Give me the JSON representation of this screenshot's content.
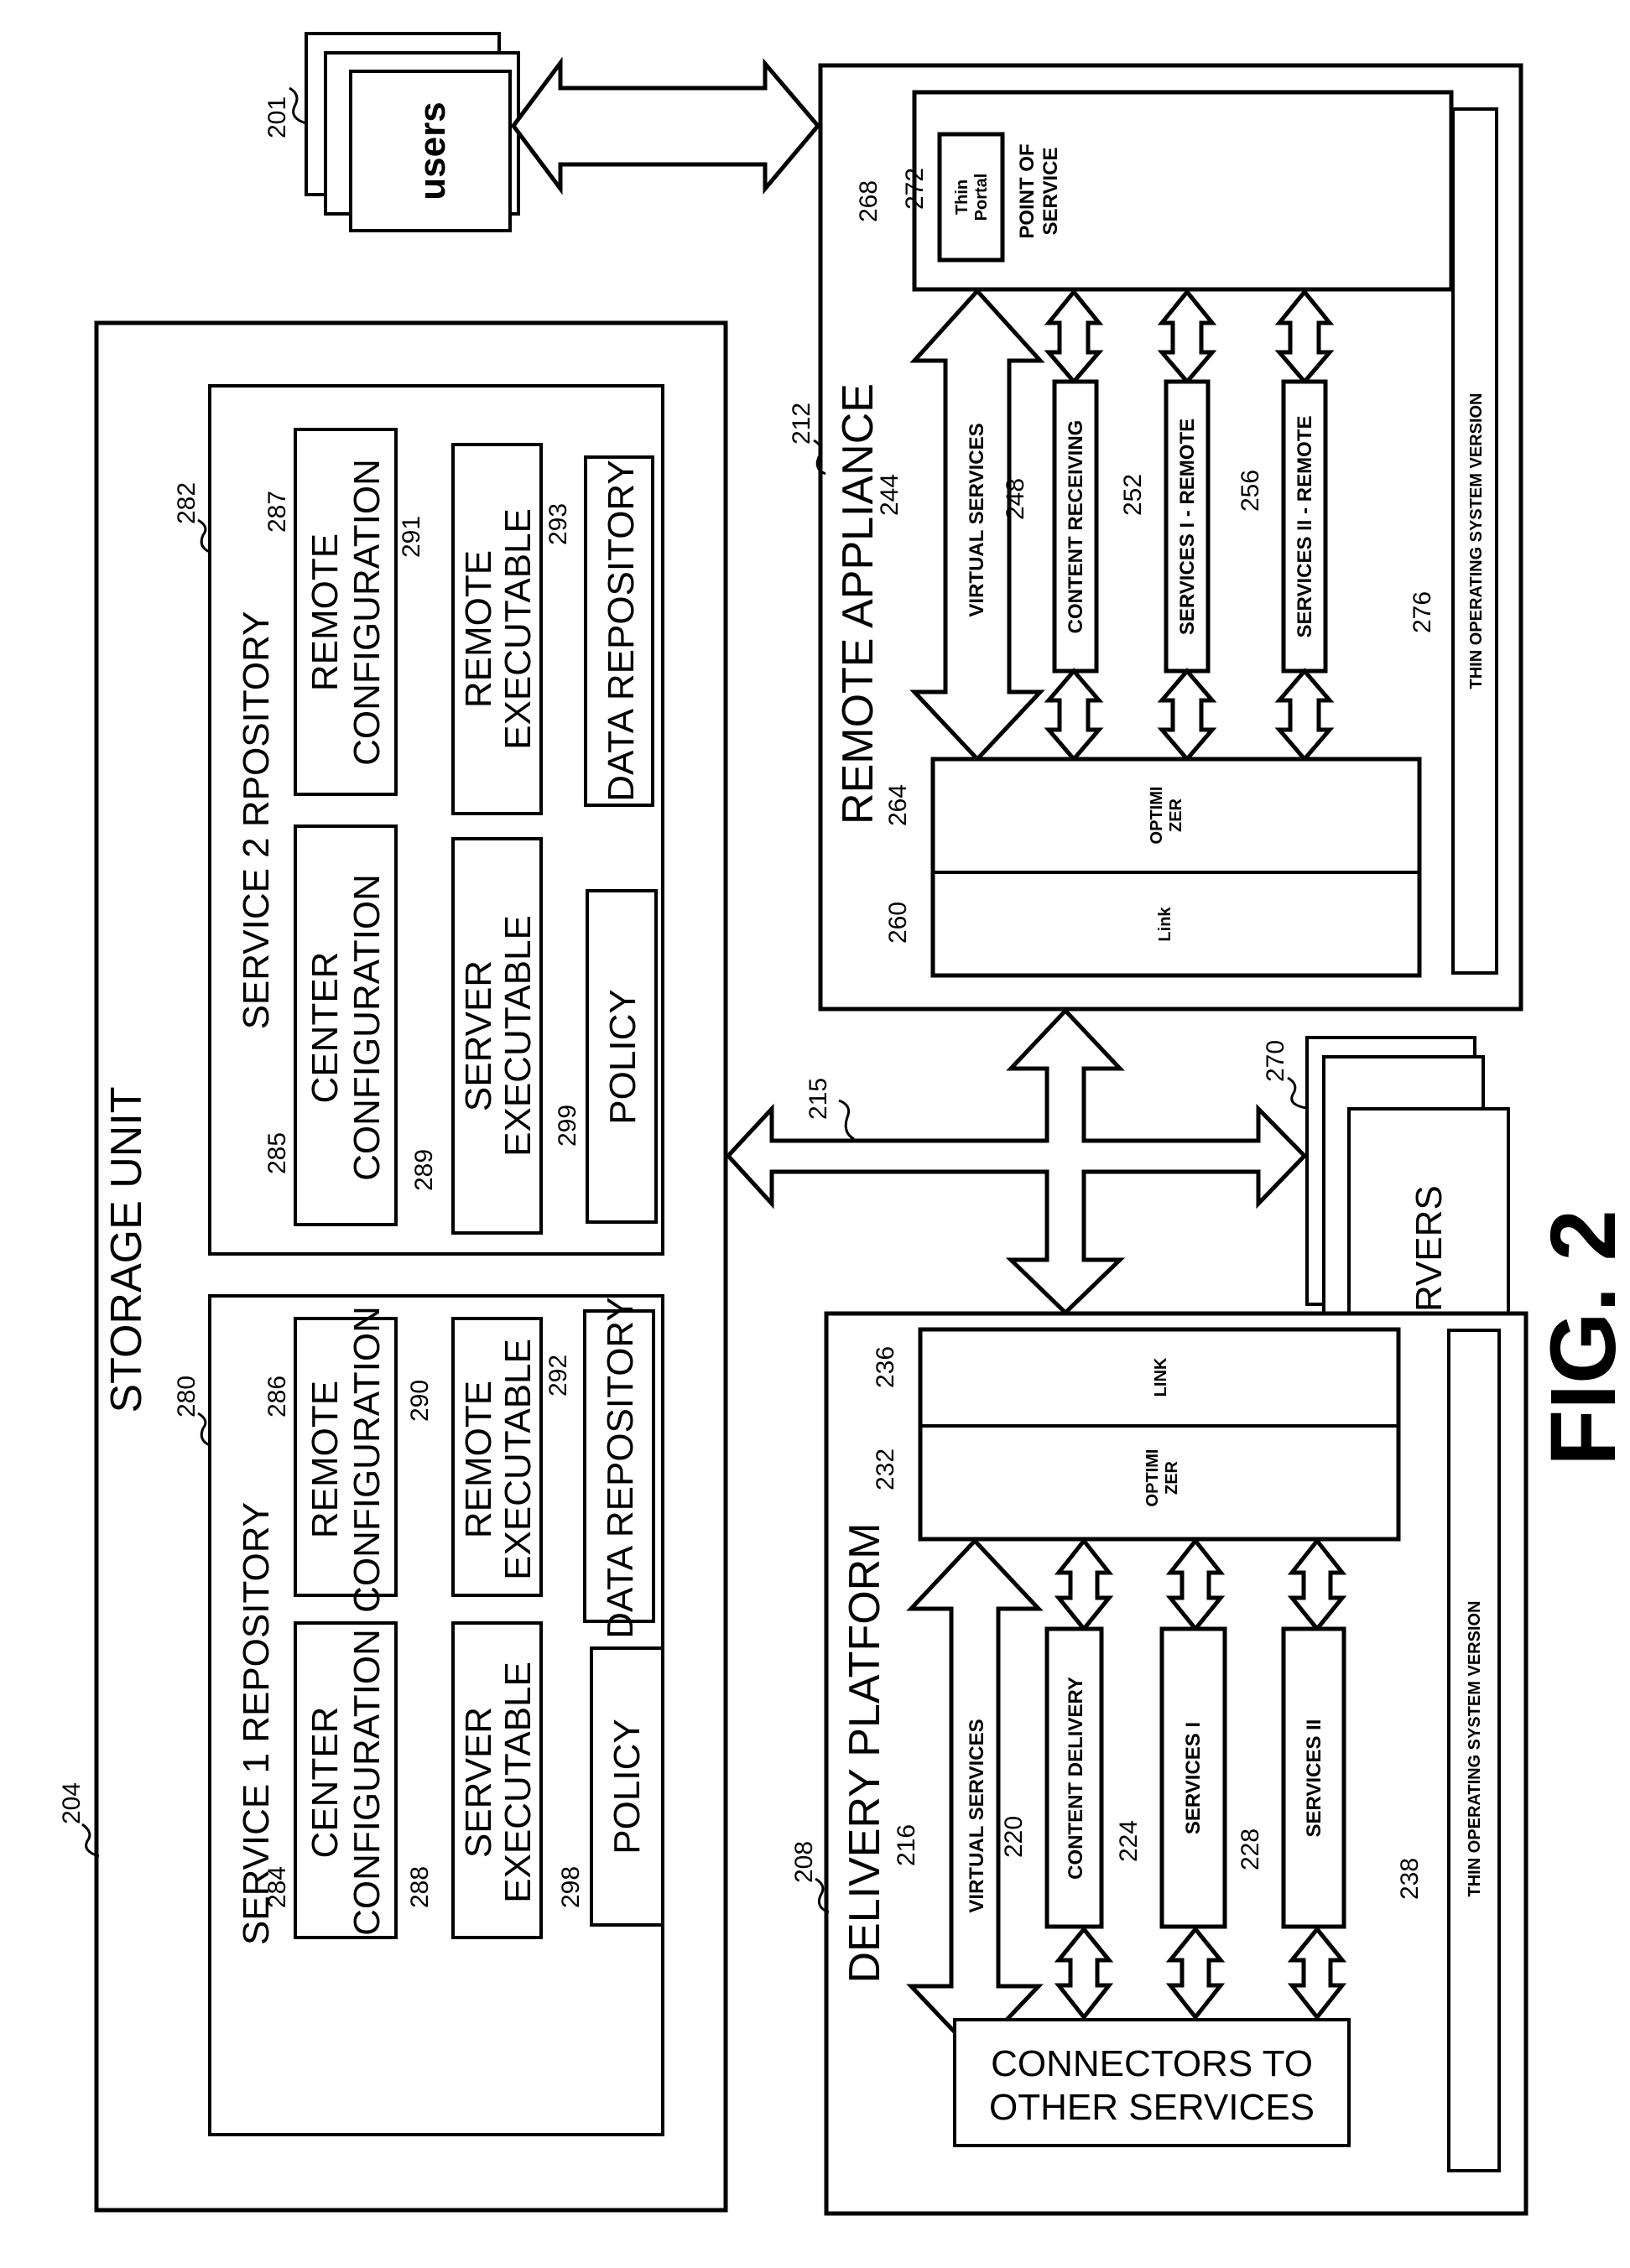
{
  "figure": {
    "label": "FIG. 2"
  },
  "users": {
    "ref": "201",
    "label": "users"
  },
  "network": {
    "ref": "215"
  },
  "servers": {
    "ref": "270",
    "label": "SERVERS"
  },
  "storage_unit": {
    "ref": "204",
    "title": "STORAGE UNIT",
    "service1": {
      "ref": "280",
      "title": "SERVICE 1 REPOSITORY",
      "center_config": {
        "ref": "284",
        "line1": "CENTER",
        "line2": "CONFIGURATION"
      },
      "remote_config": {
        "ref": "286",
        "line1": "REMOTE",
        "line2": "CONFIGURATION"
      },
      "server_exec": {
        "ref": "288",
        "line1": "SERVER",
        "line2": "EXECUTABLE"
      },
      "remote_exec": {
        "ref": "290",
        "line1": "REMOTE",
        "line2": "EXECUTABLE"
      },
      "policy": {
        "ref": "298",
        "label": "POLICY"
      },
      "data_repo": {
        "ref": "292",
        "label": "DATA REPOSITORY"
      }
    },
    "service2": {
      "ref": "282",
      "title": "SERVICE 2 RPOSITORY",
      "center_config": {
        "ref": "285",
        "line1": "CENTER",
        "line2": "CONFIGURATION"
      },
      "remote_config": {
        "ref": "287",
        "line1": "REMOTE",
        "line2": "CONFIGURATION"
      },
      "server_exec": {
        "ref": "289",
        "line1": "SERVER",
        "line2": "EXECUTABLE"
      },
      "remote_exec": {
        "ref": "291",
        "line1": "REMOTE",
        "line2": "EXECUTABLE"
      },
      "policy": {
        "ref": "299",
        "label": "POLICY"
      },
      "data_repo": {
        "ref": "293",
        "label": "DATA REPOSITORY"
      }
    }
  },
  "remote_appliance": {
    "ref": "212",
    "title": "REMOTE APPLIANCE",
    "point_of_service": {
      "ref": "268",
      "line1": "POINT OF",
      "line2": "SERVICE"
    },
    "thin_portal": {
      "ref": "272",
      "line1": "Thin",
      "line2": "Portal"
    },
    "virtual_services": {
      "ref": "244",
      "label": "VIRTUAL SERVICES"
    },
    "content_receiving": {
      "ref": "248",
      "label": "CONTENT RECEIVING"
    },
    "services1_remote": {
      "ref": "252",
      "label": "SERVICES I - REMOTE"
    },
    "services2_remote": {
      "ref": "256",
      "label": "SERVICES II - REMOTE"
    },
    "optimizer": {
      "ref": "264",
      "line1": "OPTIMI",
      "line2": "ZER"
    },
    "link": {
      "ref": "260",
      "label": "Link"
    },
    "os": {
      "ref": "276",
      "label": "THIN OPERATING SYSTEM VERSION"
    }
  },
  "delivery_platform": {
    "ref": "208",
    "title": "DELIVERY PLATFORM",
    "virtual_services": {
      "ref": "216",
      "label": "VIRTUAL SERVICES"
    },
    "content_delivery": {
      "ref": "220",
      "label": "CONTENT DELIVERY"
    },
    "services1": {
      "ref": "224",
      "label": "SERVICES I"
    },
    "services2": {
      "ref": "228",
      "label": "SERVICES II"
    },
    "optimizer": {
      "ref": "232",
      "line1": "OPTIMI",
      "line2": "ZER"
    },
    "link": {
      "ref": "236",
      "label": "LINK"
    },
    "os": {
      "ref": "238",
      "label": "THIN OPERATING SYSTEM VERSION"
    },
    "connectors": {
      "line1": "CONNECTORS TO",
      "line2": "OTHER SERVICES"
    }
  }
}
